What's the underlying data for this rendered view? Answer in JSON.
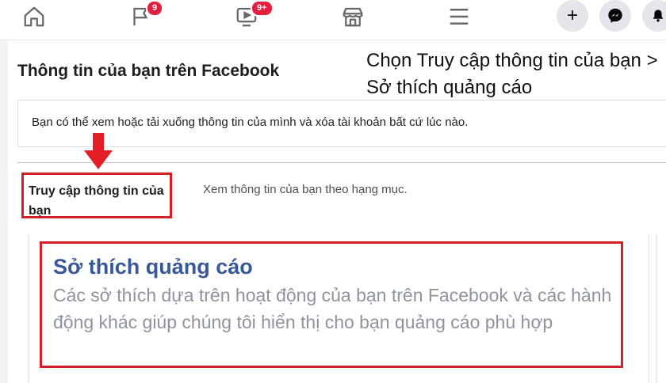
{
  "navbar": {
    "icons": [
      {
        "name": "home-icon"
      },
      {
        "name": "flag-icon",
        "badge": "9"
      },
      {
        "name": "video-icon",
        "badge": "9+"
      },
      {
        "name": "marketplace-icon"
      },
      {
        "name": "menu-icon"
      }
    ],
    "create_label": "+",
    "colors": {
      "badge": "#e41e3f",
      "button_bg": "#e4e6eb"
    }
  },
  "page": {
    "title": "Thông tin của bạn trên Facebook",
    "info_text": "Bạn có thể xem hoặc tải xuống thông tin của mình và xóa tài khoản bất cứ lúc nào."
  },
  "caption": {
    "text": "Chọn Truy cập thông tin của bạn > Sở thích quảng cáo"
  },
  "access_tab": {
    "label": "Truy cập thông tin của bạn",
    "description": "Xem thông tin của bạn theo hạng mục."
  },
  "ad_preferences": {
    "title": "Sở thích quảng cáo",
    "description": "Các sở thích dựa trên hoạt động của bạn trên Facebook và các hành động khác giúp chúng tôi hiển thị cho bạn quảng cáo phù hợp"
  },
  "colors": {
    "highlight": "#d32028",
    "link": "#385898",
    "muted": "#8d949e"
  }
}
